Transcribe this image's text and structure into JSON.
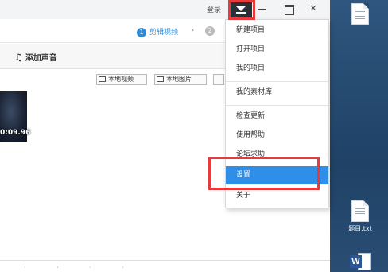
{
  "app": {
    "login_label": "登录",
    "steps": [
      {
        "num": "1",
        "label": "剪辑视频"
      },
      {
        "num": "2",
        "label": ""
      }
    ],
    "toolbar": {
      "add_audio_label": "添加声音"
    },
    "media_buttons": {
      "local_video": "本地视频",
      "local_image": "本地图片"
    },
    "thumbnail": {
      "duration": "0:09.96"
    }
  },
  "menu": {
    "items": [
      {
        "label": "新建项目"
      },
      {
        "label": "打开项目"
      },
      {
        "label": "我的项目"
      },
      {
        "label": "我的素材库"
      },
      {
        "label": "检查更新"
      },
      {
        "label": "使用帮助"
      },
      {
        "label": "论坛求助"
      },
      {
        "label": "设置",
        "highlighted": true
      },
      {
        "label": "关于"
      }
    ]
  },
  "desktop": {
    "files": [
      {
        "name": "题目.txt",
        "icon": "text-file-icon"
      },
      {
        "name": "",
        "icon": "word-doc-icon"
      }
    ]
  },
  "colors": {
    "accent": "#2f8ee8",
    "highlight_box": "#e83a3a",
    "menu_button_bg": "#2b2f36"
  }
}
